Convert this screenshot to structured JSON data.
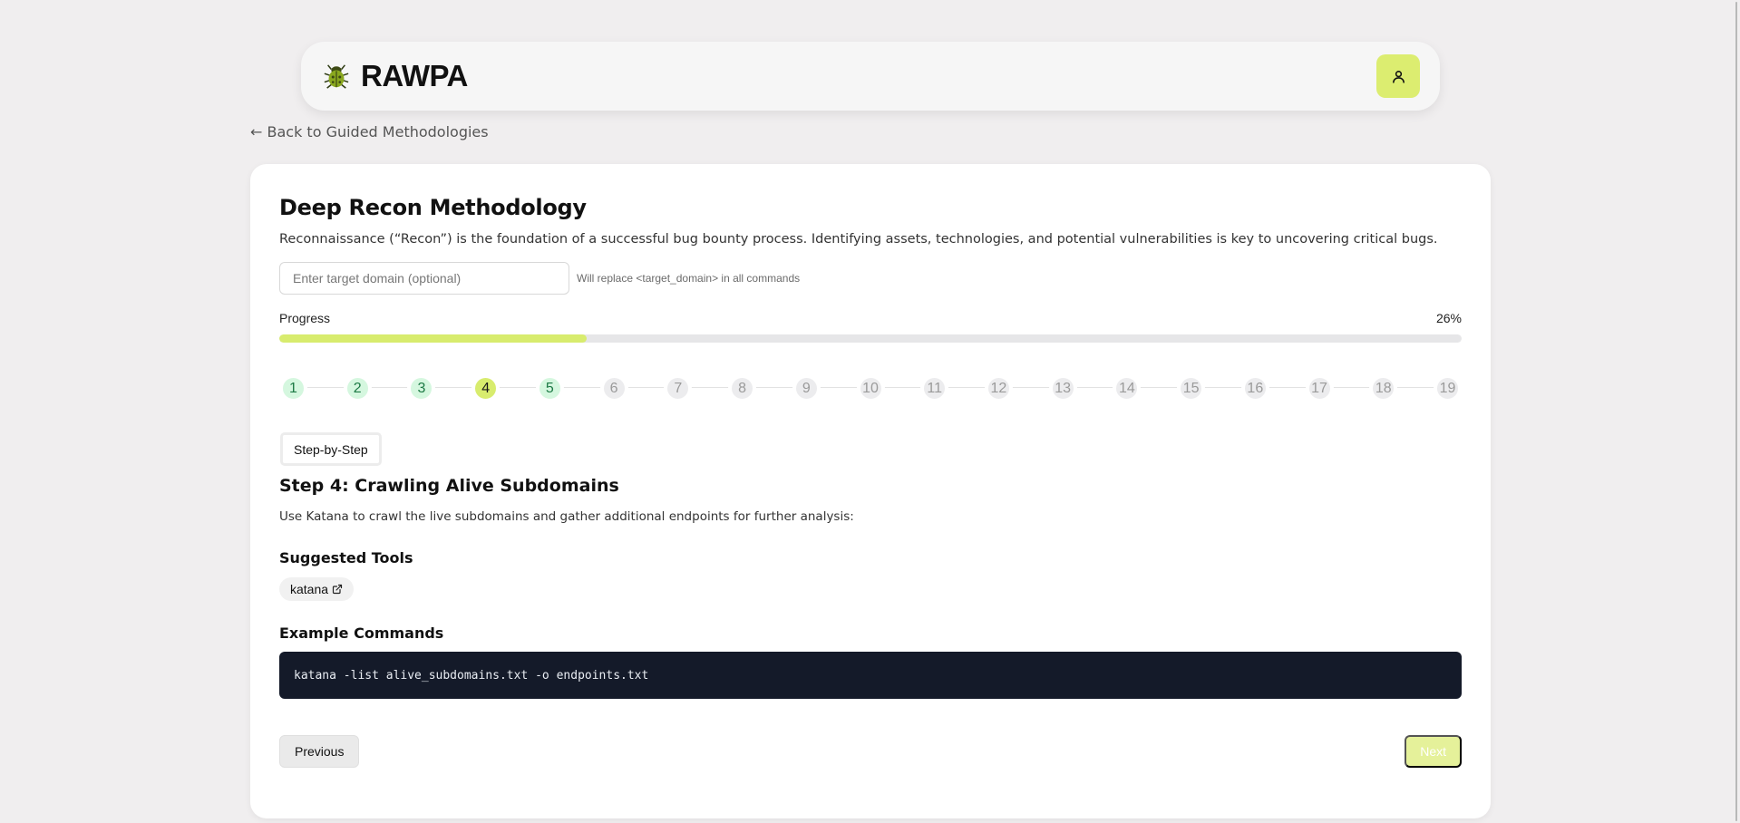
{
  "app": {
    "brand": "RAWPA",
    "accent_color": "#dced70",
    "logo_icon": "bug-icon",
    "user_icon": "user-icon"
  },
  "nav": {
    "back_link": "← Back to Guided Methodologies"
  },
  "methodology": {
    "title": "Deep Recon Methodology",
    "description": "Reconnaissance (“Recon”) is the foundation of a successful bug bounty process. Identifying assets, technologies, and potential vulnerabilities is key to uncovering critical bugs.",
    "domain_input": {
      "value": "",
      "placeholder": "Enter target domain (optional)",
      "hint": "Will replace <target_domain> in all commands"
    },
    "progress": {
      "label": "Progress",
      "percent_text": "26%",
      "fraction": 0.26
    },
    "steps": [
      {
        "label": "1",
        "state": "done"
      },
      {
        "label": "2",
        "state": "done"
      },
      {
        "label": "3",
        "state": "done"
      },
      {
        "label": "4",
        "state": "current"
      },
      {
        "label": "5",
        "state": "done"
      },
      {
        "label": "6",
        "state": "todo"
      },
      {
        "label": "7",
        "state": "todo"
      },
      {
        "label": "8",
        "state": "todo"
      },
      {
        "label": "9",
        "state": "todo"
      },
      {
        "label": "10",
        "state": "todo"
      },
      {
        "label": "11",
        "state": "todo"
      },
      {
        "label": "12",
        "state": "todo"
      },
      {
        "label": "13",
        "state": "todo"
      },
      {
        "label": "14",
        "state": "todo"
      },
      {
        "label": "15",
        "state": "todo"
      },
      {
        "label": "16",
        "state": "todo"
      },
      {
        "label": "17",
        "state": "todo"
      },
      {
        "label": "18",
        "state": "todo"
      },
      {
        "label": "19",
        "state": "todo"
      }
    ],
    "mode_button": "Step-by-Step",
    "current_step": {
      "title": "Step 4: Crawling Alive Subdomains",
      "description": "Use Katana to crawl the live subdomains and gather additional endpoints for further analysis:",
      "tools_heading": "Suggested Tools",
      "tools": [
        {
          "name": "katana",
          "icon": "external-link-icon"
        }
      ],
      "commands_heading": "Example Commands",
      "commands": [
        "katana -list alive_subdomains.txt -o endpoints.txt"
      ]
    },
    "buttons": {
      "previous": "Previous",
      "next": "Next"
    }
  }
}
